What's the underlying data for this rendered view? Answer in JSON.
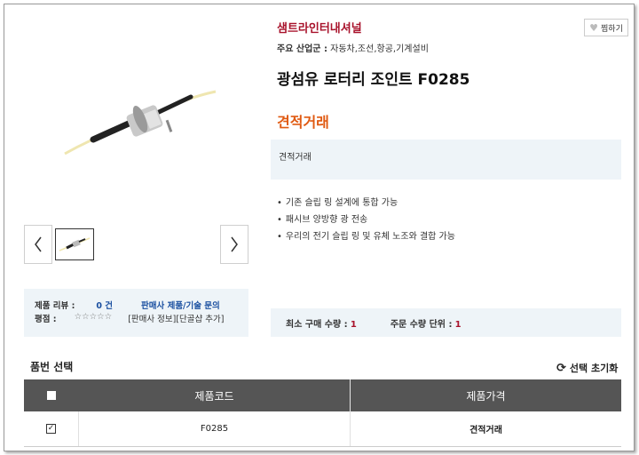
{
  "seller": {
    "name": "샘트라인터내셔널",
    "like_label": "찜하기"
  },
  "industry": {
    "label": "주요 산업군 :",
    "value": "자동차,조선,항공,기계설비"
  },
  "product": {
    "title": "광섬유 로터리 조인트 F0285",
    "price": "견적거래",
    "description": "견적거래",
    "features": [
      "기존 슬립 링 설계에 통합 가능",
      "패시브 양방향 광 전송",
      "우리의 전기 슬립 링 및 유체 노조와 결합 가능"
    ]
  },
  "gallery": {
    "prev_icon": "chevron-left-icon",
    "next_icon": "chevron-right-icon"
  },
  "review": {
    "label": "제품 리뷰 :",
    "count": "0 건",
    "inquiry_link": "판매사 제품/기술 문의",
    "rating_label": "평점 :",
    "stars": "☆☆☆☆☆",
    "seller_info": "[판매사 정보]",
    "add_contact": "[단골샵 추가]"
  },
  "order": {
    "min_label": "최소 구매 수량 :",
    "min_value": "1",
    "unit_label": "주문 수량 단위 :",
    "unit_value": "1"
  },
  "part_select": {
    "title": "품번 선택",
    "reset_label": "선택 초기화"
  },
  "table": {
    "headers": [
      "제품코드",
      "제품가격"
    ],
    "rows": [
      {
        "code": "F0285",
        "price": "견적거래",
        "checked": true
      }
    ]
  },
  "colors": {
    "brand": "#a8122b",
    "price": "#e05a12",
    "link": "#1a4fa0",
    "header_bg": "#555555",
    "panel_bg": "#eef4f8"
  }
}
